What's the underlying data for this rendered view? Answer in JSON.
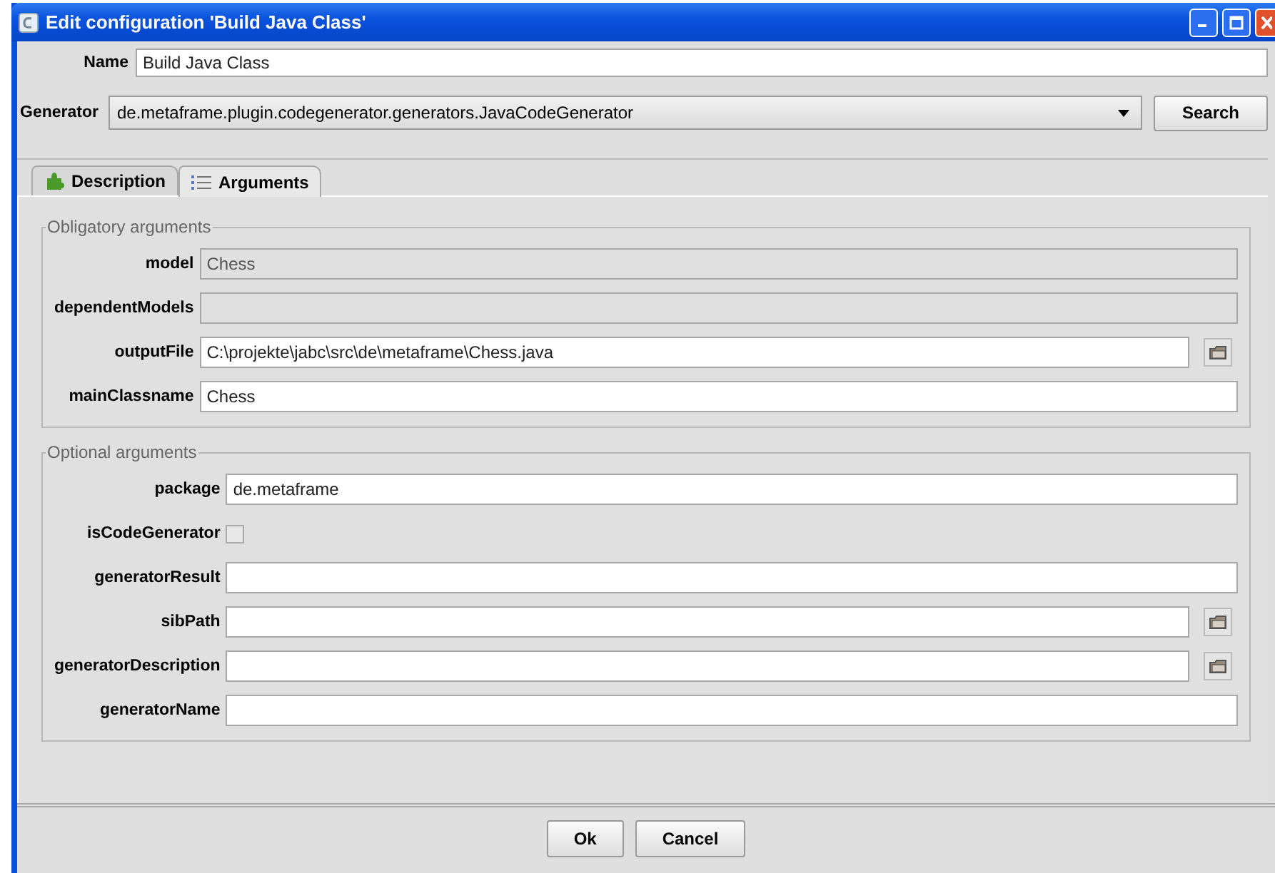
{
  "window": {
    "title": "Edit configuration 'Build Java Class'"
  },
  "name_field": {
    "label": "Name",
    "value": "Build Java Class"
  },
  "generator": {
    "label": "Generator",
    "value": "de.metaframe.plugin.codegenerator.generators.JavaCodeGenerator",
    "button": "Search"
  },
  "tabs": [
    {
      "label": "Description",
      "selected": false
    },
    {
      "label": "Arguments",
      "selected": true
    }
  ],
  "groups": [
    {
      "title": "Obligatory arguments",
      "fields": [
        {
          "label": "model",
          "kind": "text",
          "value": "Chess",
          "disabled": true
        },
        {
          "label": "dependentModels",
          "kind": "text",
          "disabled": true
        },
        {
          "label": "outputFile",
          "kind": "file",
          "value": "C:\\projekte\\jabc\\src\\de\\metaframe\\Chess.java",
          "disabled": false
        },
        {
          "label": "mainClassname",
          "kind": "text",
          "value": "Chess",
          "disabled": false
        }
      ]
    },
    {
      "title": "Optional arguments",
      "fields": [
        {
          "label": "package",
          "kind": "text",
          "value": "de.metaframe",
          "disabled": false
        },
        {
          "label": "isCodeGenerator",
          "kind": "checkbox",
          "checked": false
        },
        {
          "label": "generatorResult",
          "kind": "text",
          "disabled": false
        },
        {
          "label": "sibPath",
          "kind": "file",
          "disabled": false
        },
        {
          "label": "generatorDescription",
          "kind": "file",
          "disabled": false
        },
        {
          "label": "generatorName",
          "kind": "text",
          "disabled": false
        }
      ]
    }
  ],
  "buttons": [
    "Ok",
    "Cancel"
  ]
}
